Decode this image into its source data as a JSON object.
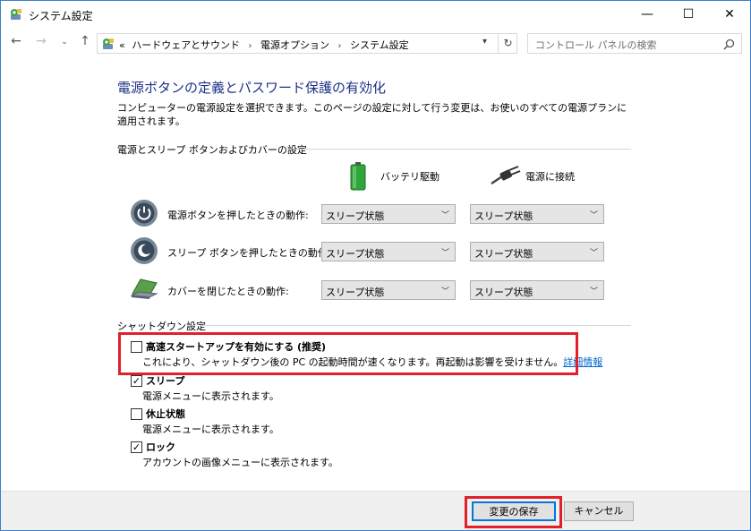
{
  "window": {
    "title": "システム設定",
    "controls": {
      "minimize": "—",
      "maximize": "☐",
      "close": "✕"
    }
  },
  "nav": {
    "back": "←",
    "forward": "→",
    "recent": "⌄",
    "up": "↑",
    "breadcrumb_prefix": "«",
    "breadcrumbs": [
      "ハードウェアとサウンド",
      "電源オプション",
      "システム設定"
    ],
    "separator": "›",
    "refresh": "↻",
    "search_placeholder": "コントロール パネルの検索"
  },
  "page": {
    "heading": "電源ボタンの定義とパスワード保護の有効化",
    "description": "コンピューターの電源設定を選択できます。このページの設定に対して行う変更は、お使いのすべての電源プランに適用されます。"
  },
  "power_section": {
    "title": "電源とスリープ ボタンおよびカバーの設定",
    "col_battery": "バッテリ駆動",
    "col_plugged": "電源に接続",
    "rows": [
      {
        "label": "電源ボタンを押したときの動作:",
        "battery": "スリープ状態",
        "plugged": "スリープ状態",
        "icon": "power-button-icon"
      },
      {
        "label": "スリープ ボタンを押したときの動作:",
        "battery": "スリープ状態",
        "plugged": "スリープ状態",
        "icon": "sleep-button-icon"
      },
      {
        "label": "カバーを閉じたときの動作:",
        "battery": "スリープ状態",
        "plugged": "スリープ状態",
        "icon": "laptop-lid-icon"
      }
    ]
  },
  "shutdown_section": {
    "title": "シャットダウン設定",
    "items": [
      {
        "title": "高速スタートアップを有効にする (推奨)",
        "desc": "これにより、シャットダウン後の PC の起動時間が速くなります。再起動は影響を受けません。",
        "link": "詳細情報",
        "checked": false
      },
      {
        "title": "スリープ",
        "desc": "電源メニューに表示されます。",
        "checked": true
      },
      {
        "title": "休止状態",
        "desc": "電源メニューに表示されます。",
        "checked": false
      },
      {
        "title": "ロック",
        "desc": "アカウントの画像メニューに表示されます。",
        "checked": true
      }
    ]
  },
  "footer": {
    "save_label": "変更の保存",
    "cancel_label": "キャンセル"
  },
  "colors": {
    "heading": "#1e3287",
    "link": "#0066cc",
    "highlight": "#e0202a",
    "window_border": "#3c80c8"
  }
}
